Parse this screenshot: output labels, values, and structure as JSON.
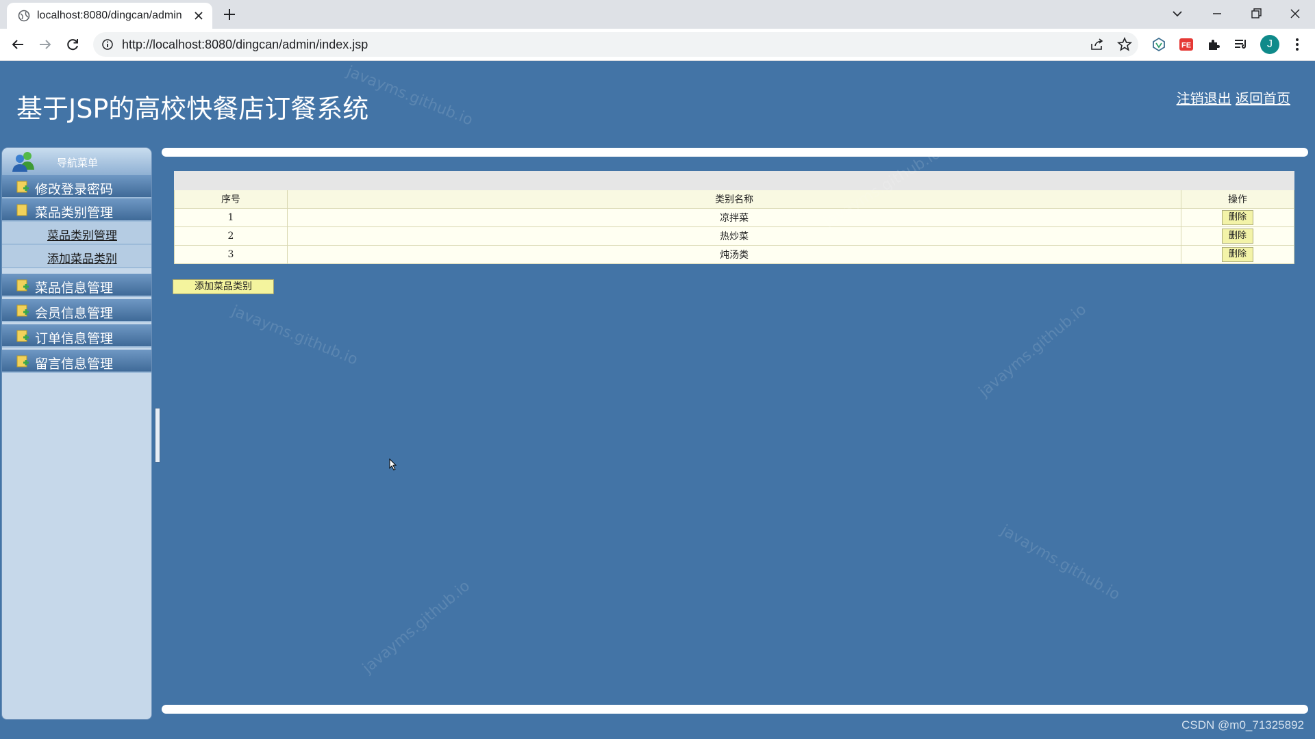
{
  "browser": {
    "tab_title": "localhost:8080/dingcan/admin",
    "url": "http://localhost:8080/dingcan/admin/index.jsp",
    "profile_initial": "J"
  },
  "header": {
    "site_title": "基于JSP的高校快餐店订餐系统",
    "logout_link": "注销退出",
    "home_link": "返回首页"
  },
  "sidebar": {
    "title": "导航菜单",
    "items": [
      {
        "label": "修改登录密码"
      },
      {
        "label": "菜品类别管理"
      },
      {
        "label": "菜品信息管理"
      },
      {
        "label": "会员信息管理"
      },
      {
        "label": "订单信息管理"
      },
      {
        "label": "留言信息管理"
      }
    ],
    "subitems": [
      {
        "label": "菜品类别管理"
      },
      {
        "label": "添加菜品类别"
      }
    ]
  },
  "table": {
    "headers": [
      "序号",
      "类别名称",
      "操作"
    ],
    "rows": [
      {
        "no": "1",
        "name": "凉拌菜",
        "action": "删除"
      },
      {
        "no": "2",
        "name": "热炒菜",
        "action": "删除"
      },
      {
        "no": "3",
        "name": "炖汤类",
        "action": "删除"
      }
    ]
  },
  "add_button_label": "添加菜品类别",
  "watermark_text": "javayms.github.io",
  "footer_credit": "CSDN @m0_71325892",
  "colors": {
    "page_bg": "#4374a6",
    "sidebar_bg": "#c6d8ea",
    "button_yellow": "#f4f49e"
  }
}
